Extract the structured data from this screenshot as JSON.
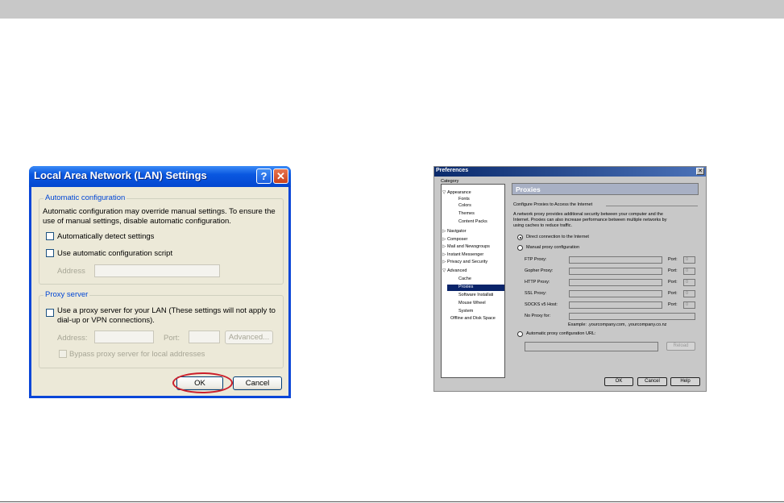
{
  "lan_dialog": {
    "title": "Local Area Network (LAN) Settings",
    "help_btn": "?",
    "close_btn": "✕",
    "auto_config": {
      "group_title": "Automatic configuration",
      "desc_line1": "Automatic configuration may override manual settings.  To ensure the",
      "desc_line2": "use of manual settings, disable automatic configuration.",
      "auto_detect_label": "Automatically detect settings",
      "auto_script_label": "Use automatic configuration script",
      "address_label": "Address",
      "address_value": ""
    },
    "proxy": {
      "group_title": "Proxy server",
      "use_proxy_line1": "Use a proxy server for your LAN (These settings will not apply to",
      "use_proxy_line2": "dial-up or VPN connections).",
      "address_label": "Address:",
      "port_label": "Port:",
      "advanced_label": "Advanced...",
      "bypass_label": "Bypass proxy server for local addresses"
    },
    "ok_label": "OK",
    "cancel_label": "Cancel"
  },
  "pref_dialog": {
    "title": "Preferences",
    "close_btn": "✕",
    "category_label": "Category",
    "categories": {
      "appearance": "Appearance",
      "fonts": "Fonts",
      "colors": "Colors",
      "themes": "Themes",
      "content_packs": "Content Packs",
      "navigator": "Navigator",
      "composer": "Composer",
      "mail": "Mail and Newsgroups",
      "im": "Instant Messenger",
      "privacy": "Privacy and Security",
      "advanced": "Advanced",
      "cache": "Cache",
      "proxies": "Proxies",
      "software": "Software Installati",
      "mouse": "Mouse Wheel",
      "system": "System",
      "offline": "Offline and Disk Space"
    },
    "panel_title": "Proxies",
    "configure_heading": "Configure Proxies to Access the Internet",
    "desc_line1": "A network proxy provides additional security between your computer and the",
    "desc_line2": "Internet. Proxies can also increase performance between multiple networks by",
    "desc_line3": "using caches to reduce traffic.",
    "direct_label": "Direct connection to the Internet",
    "manual_label": "Manual proxy configuration",
    "proxies": [
      {
        "label": "FTP Proxy:",
        "port_label": "Port:",
        "port_value": "0"
      },
      {
        "label": "Gopher Proxy:",
        "port_label": "Port:",
        "port_value": "0"
      },
      {
        "label": "HTTP Proxy:",
        "port_label": "Port:",
        "port_value": "0"
      },
      {
        "label": "SSL Proxy:",
        "port_label": "Port:",
        "port_value": "0"
      },
      {
        "label": "SOCKS v5 Host:",
        "port_label": "Port:",
        "port_value": "0"
      }
    ],
    "no_proxy_label": "No Proxy for:",
    "example_text": "Example: .yourcompany.com, .yourcompany.co.nz",
    "auto_url_label": "Automatic proxy configuration URL:",
    "reload_label": "Reload",
    "ok_label": "OK",
    "cancel_label": "Cancel",
    "help_label": "Help"
  }
}
